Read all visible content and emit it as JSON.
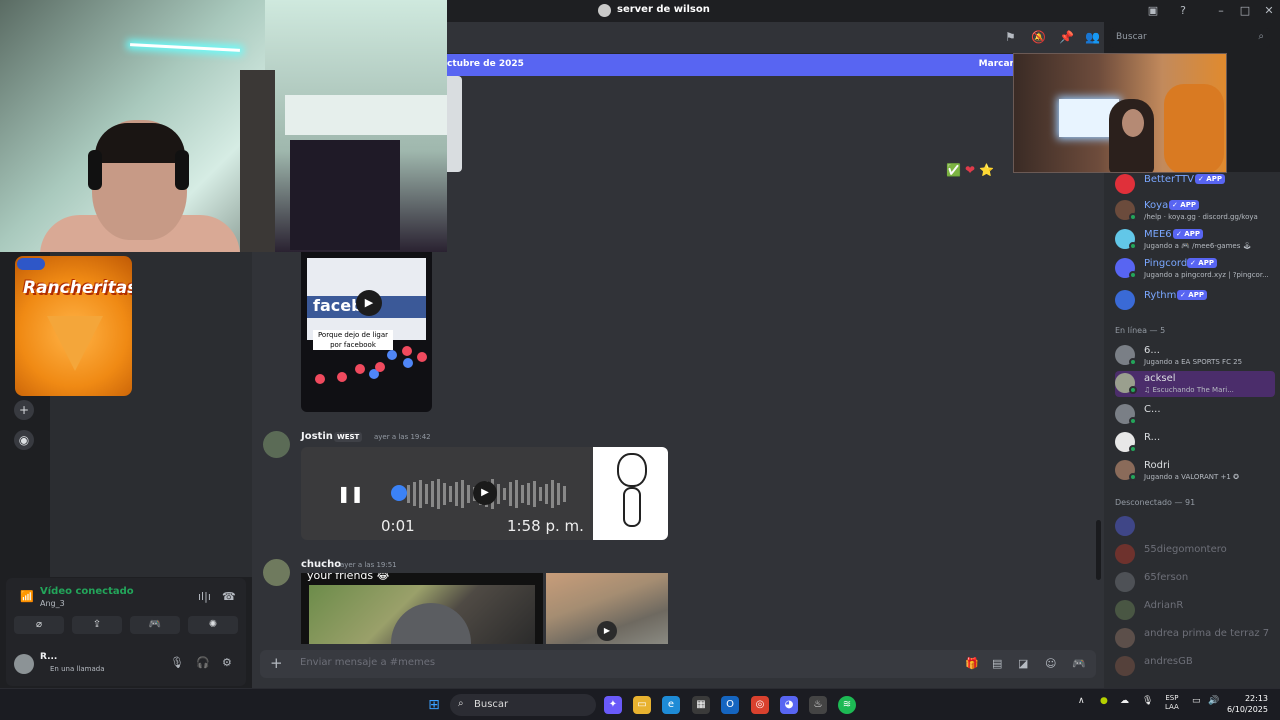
{
  "window": {
    "title": "server de wilson"
  },
  "header": {
    "search_placeholder": "Buscar",
    "icons": [
      "threads-icon",
      "mute-icon",
      "pin-icon",
      "members-icon"
    ]
  },
  "banner": {
    "left_text": "ctubre de 2025",
    "right_text": "Marcar"
  },
  "reactions": [
    "✅",
    "❤",
    "⭐"
  ],
  "fb_embed": {
    "caption": "Porque dejo de ligar por facebook",
    "brand": "facebo"
  },
  "messages": [
    {
      "author": "Jostin",
      "tag": "WEST",
      "time": "ayer a las 19:42",
      "audio": {
        "elapsed": "0:01",
        "clock": "1:58 p. m."
      }
    },
    {
      "author": "chucho",
      "time": "ayer a las 19:51",
      "video_caption": "your friends 😂"
    }
  ],
  "composer": {
    "placeholder": "Enviar mensaje a #memes"
  },
  "voice_panel": {
    "status": "Vídeo conectado",
    "channel": "Ang_3"
  },
  "user_panel": {
    "name": "R...",
    "status": "En una llamada"
  },
  "chips": {
    "brand": "Rancheritas"
  },
  "members": {
    "apps": [
      {
        "name": "BetterTTV",
        "badge": "✓ APP",
        "sub": ""
      },
      {
        "name": "Koya",
        "badge": "✓ APP",
        "sub": "/help · koya.gg · discord.gg/koya"
      },
      {
        "name": "MEE6",
        "badge": "✓ APP",
        "sub": "Jugando a 🎮 /mee6-games 🕹"
      },
      {
        "name": "Pingcord",
        "badge": "✓ APP",
        "sub": "Jugando a pingcord.xyz | ?pingcor..."
      },
      {
        "name": "Rythm",
        "badge": "✓ APP",
        "sub": ""
      }
    ],
    "online_header": "En línea — 5",
    "online": [
      {
        "name": "6...",
        "sub": "Jugando a EA SPORTS FC 25"
      },
      {
        "name": "acksel",
        "sub": "♫ Escuchando The Mari..."
      },
      {
        "name": "C...",
        "sub": ""
      },
      {
        "name": "R...",
        "sub": ""
      },
      {
        "name": "Rodri",
        "sub": "Jugando a VALORANT +1 ✪"
      }
    ],
    "offline_header": "Desconectado — 91",
    "offline": [
      "",
      "55diegomontero",
      "65ferson",
      "AdrianR",
      "andrea prima de terraz 7",
      "andresGB"
    ]
  },
  "taskbar": {
    "search": "Buscar",
    "lang1": "ESP",
    "lang2": "LAA",
    "time": "22:13",
    "date": "6/10/2025"
  },
  "colors": {
    "blurple": "#5865f2",
    "green": "#23a55a",
    "bg_chat": "#313338",
    "bg_side": "#2b2d31"
  }
}
